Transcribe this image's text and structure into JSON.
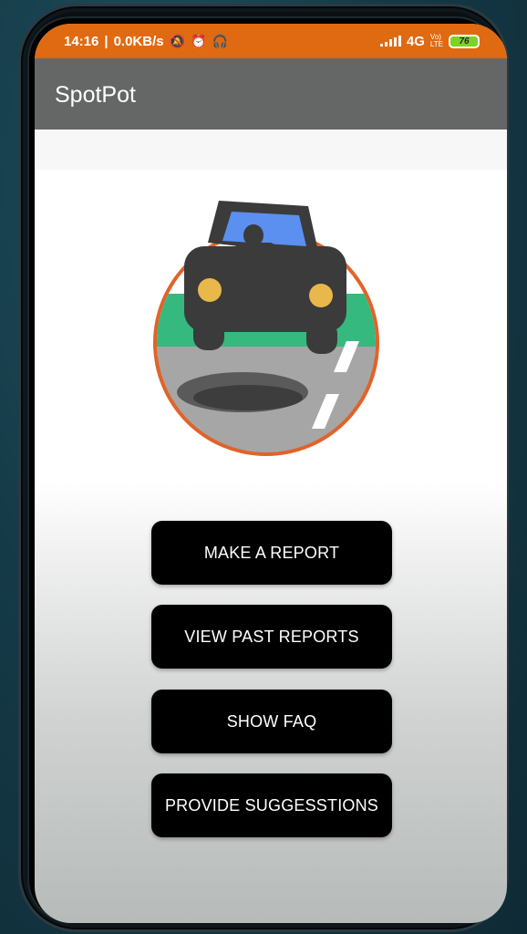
{
  "status_bar": {
    "time": "14:16",
    "speed": "0.0KB/s",
    "network": "4G",
    "volte": "VoLTE",
    "battery": "76",
    "color": "#e06a12"
  },
  "app_bar": {
    "title": "SpotPot",
    "color": "#646766"
  },
  "logo": {
    "icon": "car-pothole-icon"
  },
  "menu": {
    "make_report": "MAKE A REPORT",
    "view_past": "VIEW PAST REPORTS",
    "show_faq": "SHOW FAQ",
    "suggestions": "PROVIDE SUGGESSTIONS"
  }
}
